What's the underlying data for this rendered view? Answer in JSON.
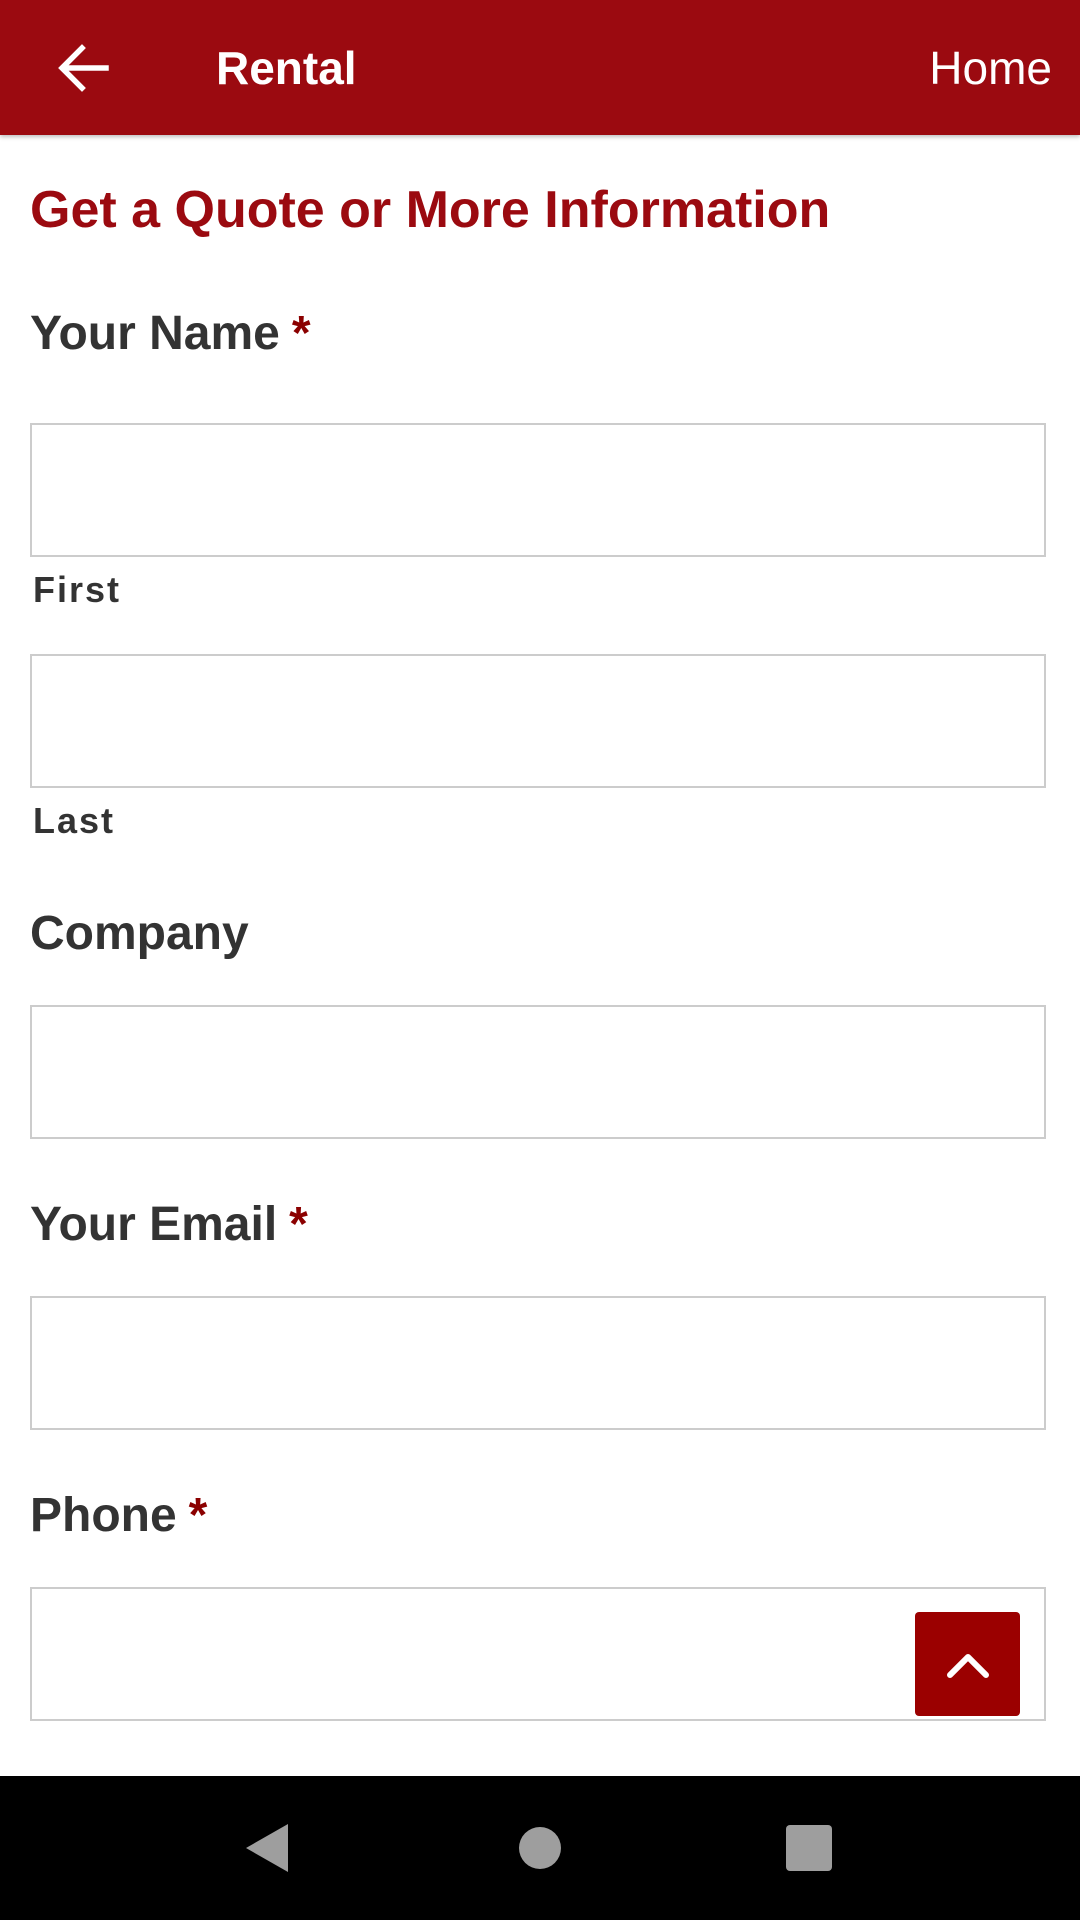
{
  "appbar": {
    "back_icon": "arrow-left-icon",
    "title": "Rental",
    "home_label": "Home",
    "color": "#9b0a10"
  },
  "form": {
    "title": "Get a Quote or More Information",
    "required_marker": "*",
    "name": {
      "label": "Your Name",
      "first_sublabel": "First",
      "last_sublabel": "Last",
      "first_value": "",
      "last_value": ""
    },
    "company": {
      "label": "Company",
      "value": ""
    },
    "email": {
      "label": "Your Email",
      "value": ""
    },
    "phone": {
      "label": "Phone",
      "value": ""
    }
  },
  "scroll_top": {
    "icon": "chevron-up-icon"
  },
  "system_nav": {
    "back": "triangle-back-icon",
    "home": "circle-home-icon",
    "recents": "square-recents-icon"
  }
}
